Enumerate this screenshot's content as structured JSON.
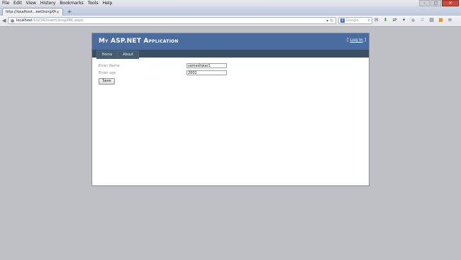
{
  "browser": {
    "menu": [
      "File",
      "Edit",
      "View",
      "History",
      "Bookmarks",
      "Tools",
      "Help"
    ],
    "window_controls": {
      "minimize": "–",
      "maximize": "□",
      "close": "✕"
    },
    "tab": {
      "title": "http://localhost...eetUsingXML.aspx",
      "close": "×"
    },
    "new_tab": "+",
    "url": {
      "host": "localhost",
      "path": ":51234/InsertUsingXML.aspx"
    },
    "search": {
      "engine_badge": "8",
      "placeholder": "Google"
    }
  },
  "app": {
    "title": "My ASP.NET Application",
    "login": {
      "open": "[ ",
      "link": "Log In",
      "close": " ]"
    },
    "nav": [
      "Home",
      "About"
    ]
  },
  "form": {
    "name_label": "Enter Name",
    "name_value": "sameshwar1",
    "age_label": "Enter age",
    "age_value": "2001",
    "save_label": "Save"
  },
  "colors": {
    "header": "#4b6c9e",
    "nav_bar": "#3a4f63",
    "desktop_bg": "#bfc0c5"
  }
}
